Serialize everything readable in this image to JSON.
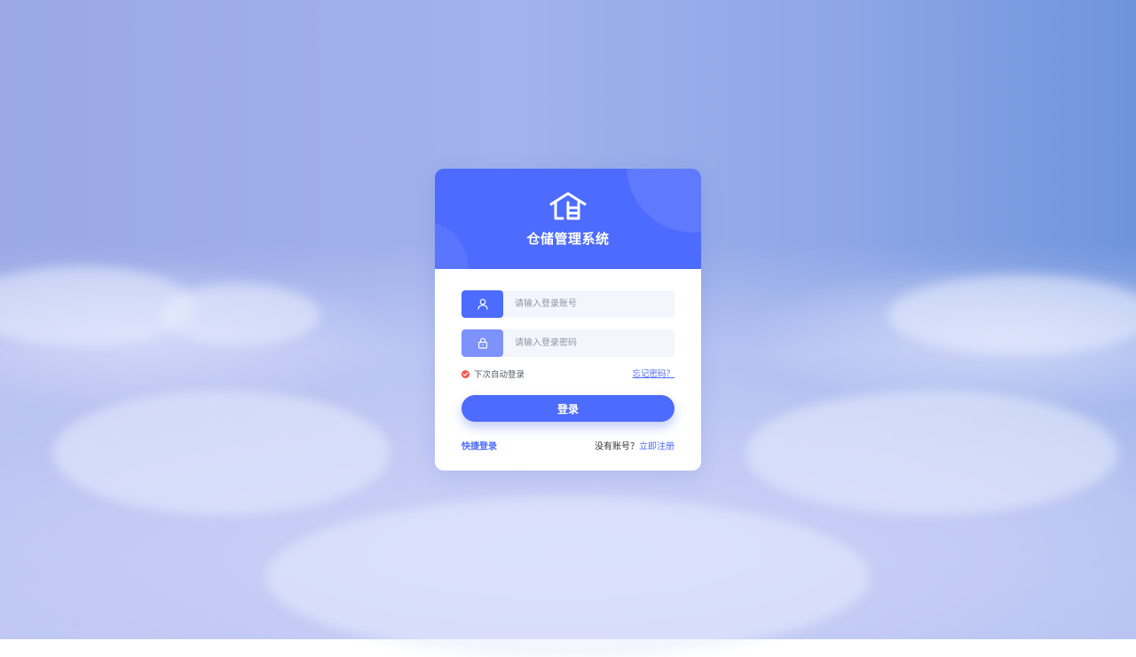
{
  "app": {
    "title": "仓储管理系统"
  },
  "login_form": {
    "account_placeholder": "请输入登录账号",
    "password_placeholder": "请输入登录密码",
    "remember_label": "下次自动登录",
    "remember_checked": true,
    "forgot_label": "忘记密码？",
    "submit_label": "登录",
    "quick_login_label": "快捷登录",
    "no_account_text": "没有账号？",
    "register_label": "立即注册"
  },
  "icons": {
    "logo": "warehouse-icon",
    "account": "user-icon",
    "password": "lock-icon",
    "remember": "check-circle-icon"
  },
  "colors": {
    "primary": "#4d6bfe",
    "primary_light": "#7e92fb",
    "check": "#f0574a",
    "field_bg": "#f3f6fc"
  }
}
